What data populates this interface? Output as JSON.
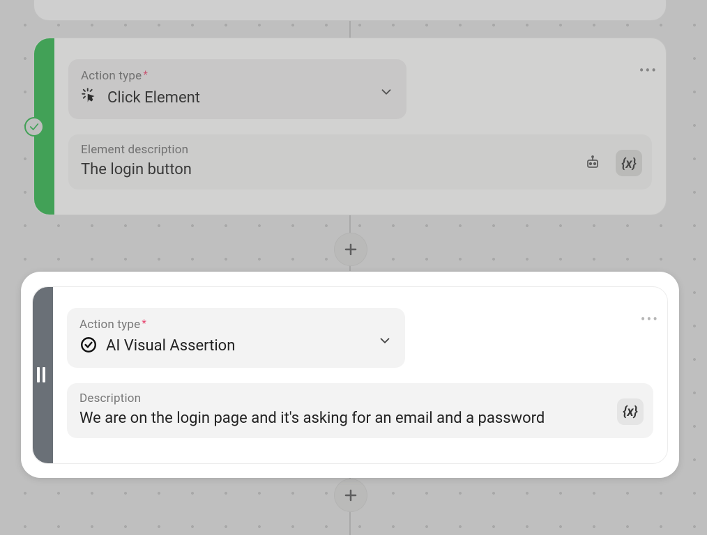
{
  "card1": {
    "action_type_label": "Action type",
    "action_name": "Click Element",
    "element_desc_label": "Element description",
    "element_desc_value": "The login button"
  },
  "card2": {
    "action_type_label": "Action type",
    "action_name": "AI Visual Assertion",
    "desc_label": "Description",
    "desc_value": "We are on the login page and it's asking for an email and a password"
  },
  "glyphs": {
    "variable": "{x}",
    "required": "*",
    "more": "•••"
  }
}
